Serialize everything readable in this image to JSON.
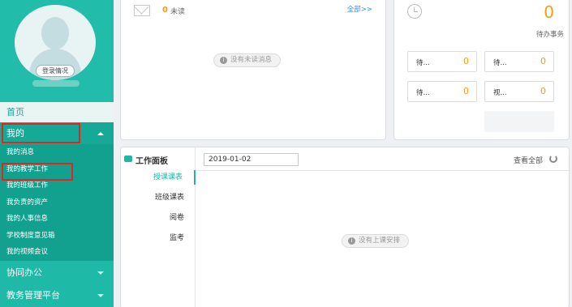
{
  "sidebar": {
    "login_label": "登录情况",
    "home": "首页",
    "mine_group": "我的",
    "mine_items": [
      "我的消息",
      "我的教学工作",
      "我的班级工作",
      "我负责的资产",
      "我的人事信息",
      "学校制度意见箱",
      "我的视频会议"
    ],
    "coop_group": "协同办公",
    "edu_group": "教务管理平台"
  },
  "messages": {
    "count": "0",
    "unread_label": "未读",
    "all_link": "全部>>",
    "empty_text": "没有未读消息"
  },
  "todo": {
    "count": "0",
    "label": "待办事务",
    "items": [
      {
        "label": "待...",
        "value": "0"
      },
      {
        "label": "待...",
        "value": "0"
      },
      {
        "label": "待...",
        "value": "0"
      },
      {
        "label": "视...",
        "value": "0"
      }
    ]
  },
  "work": {
    "title": "工作面板",
    "tabs": [
      "授课课表",
      "班级课表",
      "阅卷",
      "监考"
    ],
    "date": "2019-01-02",
    "view_all": "查看全部",
    "empty_text": "没有上课安排"
  },
  "colors": {
    "accent": "#1fb9a7",
    "highlight": "#e0261f",
    "number": "#f39c12"
  }
}
